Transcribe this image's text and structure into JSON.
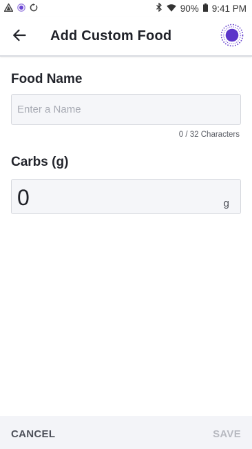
{
  "status_bar": {
    "left_icons": [
      "alert-triangle-icon",
      "app-dot-icon",
      "sync-circle-icon"
    ],
    "right_icons": [
      "bluetooth-icon",
      "wifi-icon"
    ],
    "battery": "90%",
    "battery_icon": "battery-icon",
    "time": "9:41 PM"
  },
  "app_bar": {
    "title": "Add Custom Food",
    "back_icon": "arrow-left-icon",
    "sensor_icon": "sensor-icon"
  },
  "food_name": {
    "label": "Food Name",
    "value": "",
    "placeholder": "Enter a Name",
    "counter": "0 / 32 Characters"
  },
  "carbs": {
    "label": "Carbs (g)",
    "value": "0",
    "unit": "g"
  },
  "actions": {
    "cancel_label": "CANCEL",
    "save_label": "SAVE"
  },
  "colors": {
    "accent": "#5b35c9",
    "disabled": "#b7b9c0",
    "field_bg": "#f5f6f9"
  }
}
